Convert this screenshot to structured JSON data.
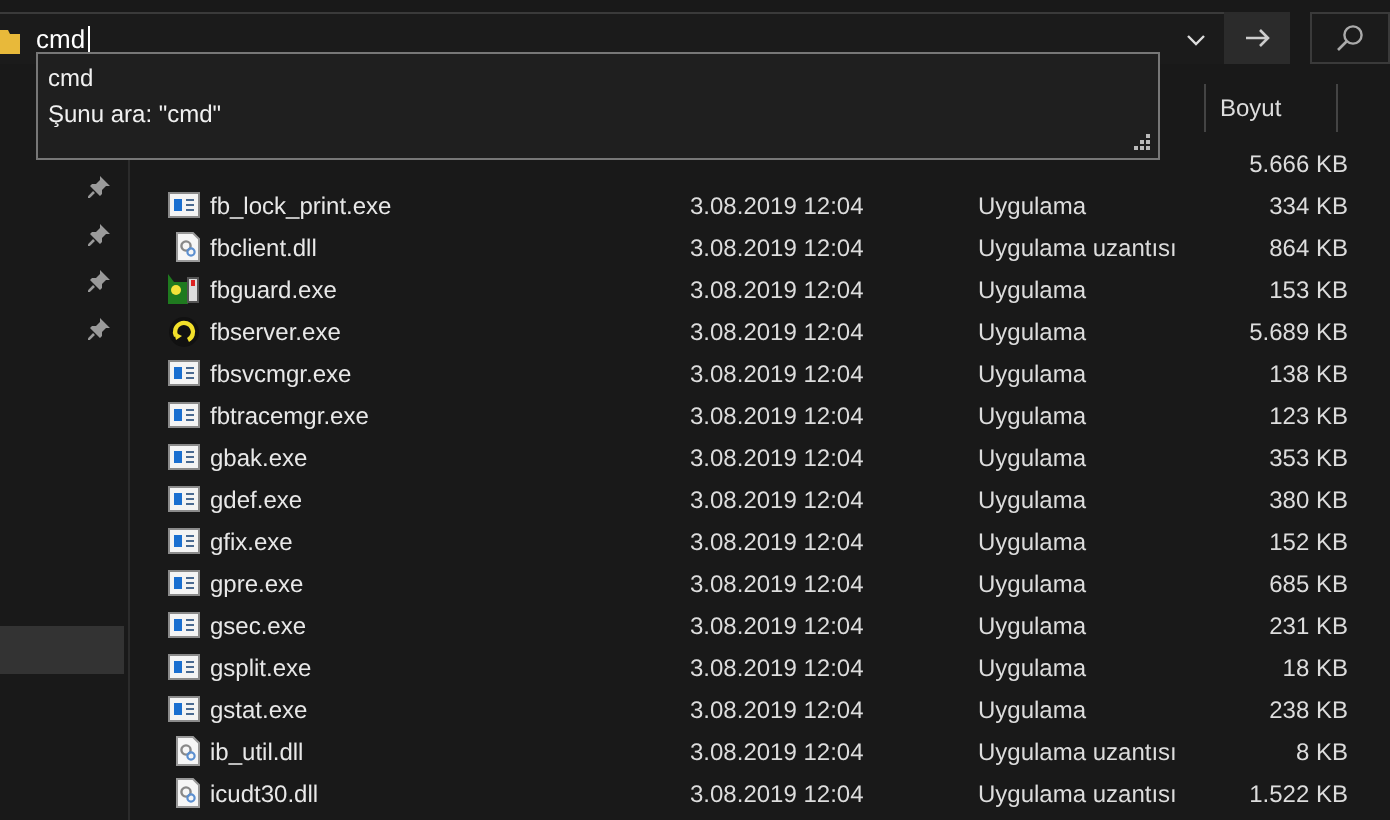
{
  "address_bar": {
    "value": "cmd"
  },
  "suggestions": [
    {
      "text": "cmd"
    },
    {
      "text": "Şunu ara: \"cmd\""
    }
  ],
  "columns": [
    {
      "label": "Boyut"
    }
  ],
  "nav_items": [
    {
      "pinned": true,
      "selected": false
    },
    {
      "pinned": true,
      "selected": false
    },
    {
      "pinned": true,
      "selected": false
    },
    {
      "pinned": true,
      "selected": false
    },
    {
      "pinned": false,
      "selected": true
    }
  ],
  "files": [
    {
      "size": "5.666 KB"
    },
    {
      "name": "fb_lock_print.exe",
      "date": "3.08.2019 12:04",
      "type": "Uygulama",
      "size": "334 KB",
      "kind": "app"
    },
    {
      "name": "fbclient.dll",
      "date": "3.08.2019 12:04",
      "type": "Uygulama uzantısı",
      "size": "864 KB",
      "kind": "dll"
    },
    {
      "name": "fbguard.exe",
      "date": "3.08.2019 12:04",
      "type": "Uygulama",
      "size": "153 KB",
      "kind": "guard"
    },
    {
      "name": "fbserver.exe",
      "date": "3.08.2019 12:04",
      "type": "Uygulama",
      "size": "5.689 KB",
      "kind": "server"
    },
    {
      "name": "fbsvcmgr.exe",
      "date": "3.08.2019 12:04",
      "type": "Uygulama",
      "size": "138 KB",
      "kind": "app"
    },
    {
      "name": "fbtracemgr.exe",
      "date": "3.08.2019 12:04",
      "type": "Uygulama",
      "size": "123 KB",
      "kind": "app"
    },
    {
      "name": "gbak.exe",
      "date": "3.08.2019 12:04",
      "type": "Uygulama",
      "size": "353 KB",
      "kind": "app"
    },
    {
      "name": "gdef.exe",
      "date": "3.08.2019 12:04",
      "type": "Uygulama",
      "size": "380 KB",
      "kind": "app"
    },
    {
      "name": "gfix.exe",
      "date": "3.08.2019 12:04",
      "type": "Uygulama",
      "size": "152 KB",
      "kind": "app"
    },
    {
      "name": "gpre.exe",
      "date": "3.08.2019 12:04",
      "type": "Uygulama",
      "size": "685 KB",
      "kind": "app"
    },
    {
      "name": "gsec.exe",
      "date": "3.08.2019 12:04",
      "type": "Uygulama",
      "size": "231 KB",
      "kind": "app"
    },
    {
      "name": "gsplit.exe",
      "date": "3.08.2019 12:04",
      "type": "Uygulama",
      "size": "18 KB",
      "kind": "app"
    },
    {
      "name": "gstat.exe",
      "date": "3.08.2019 12:04",
      "type": "Uygulama",
      "size": "238 KB",
      "kind": "app"
    },
    {
      "name": "ib_util.dll",
      "date": "3.08.2019 12:04",
      "type": "Uygulama uzantısı",
      "size": "8 KB",
      "kind": "dll"
    },
    {
      "name": "icudt30.dll",
      "date": "3.08.2019 12:04",
      "type": "Uygulama uzantısı",
      "size": "1.522 KB",
      "kind": "dll"
    }
  ]
}
